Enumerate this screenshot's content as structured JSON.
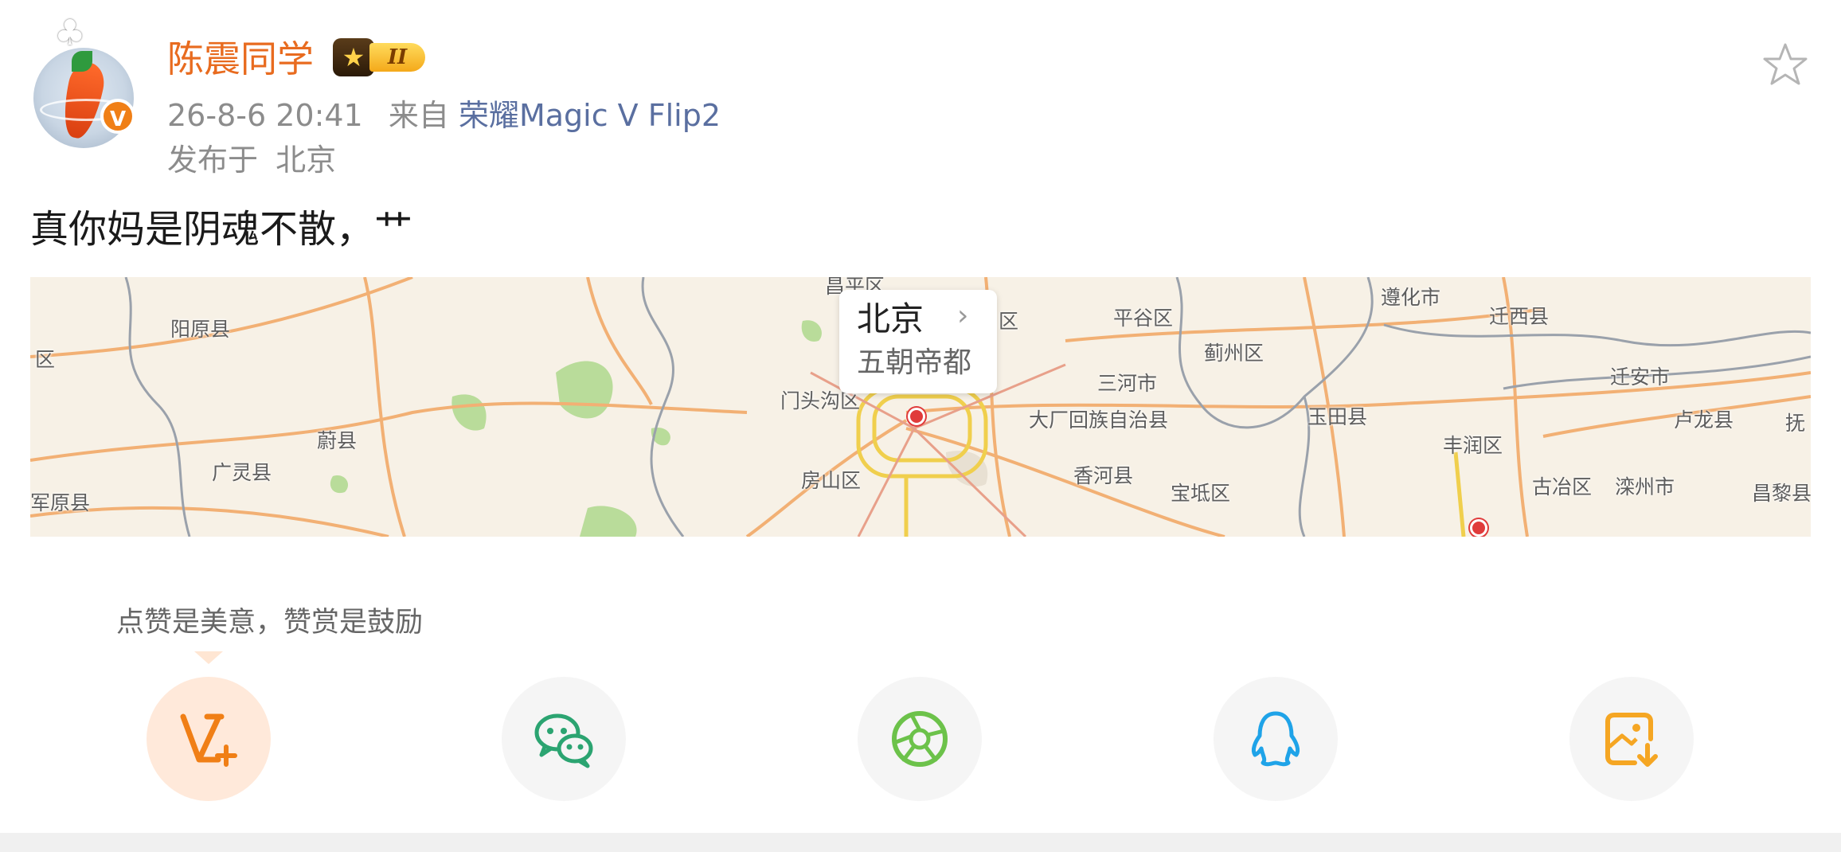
{
  "post": {
    "username": "陈震同学",
    "level_badge": "II",
    "verified_badge": "V",
    "timestamp": "26-8-6 20:41",
    "source_prefix": "来自",
    "source_device": "荣耀Magic V Flip2",
    "location_prefix": "发布于",
    "location": "北京",
    "text": "真你妈是阴魂不散，艹"
  },
  "map": {
    "popup_title": "北京",
    "popup_subtitle": "五朝帝都",
    "labels": [
      "阳原县",
      "区",
      "蔚县",
      "广灵县",
      "军原县",
      "门头沟区",
      "房山区",
      "昌平区",
      "区",
      "平谷区",
      "蓟州区",
      "三河市",
      "大厂回族自治县",
      "香河县",
      "宝坻区",
      "玉田县",
      "遵化市",
      "迁西县",
      "迁安市",
      "丰润区",
      "古冶区",
      "滦州市",
      "卢龙县",
      "抚",
      "昌黎县"
    ]
  },
  "reward": {
    "text": "点赞是美意，赞赏是鼓励"
  },
  "share": [
    {
      "name": "reward",
      "icon": "reward-v-plus-icon"
    },
    {
      "name": "wechat",
      "icon": "wechat-icon"
    },
    {
      "name": "moments",
      "icon": "moments-icon"
    },
    {
      "name": "qq",
      "icon": "qq-icon"
    },
    {
      "name": "save-image",
      "icon": "save-image-icon"
    }
  ],
  "colors": {
    "username": "#e86b1f",
    "source": "#5a6fa0",
    "meta": "#8c8c8c",
    "reward_icon": "#f07f16",
    "wechat": "#2ba471",
    "moments": "#6cc24a",
    "qq": "#1fa3e8",
    "save": "#f5a623"
  }
}
